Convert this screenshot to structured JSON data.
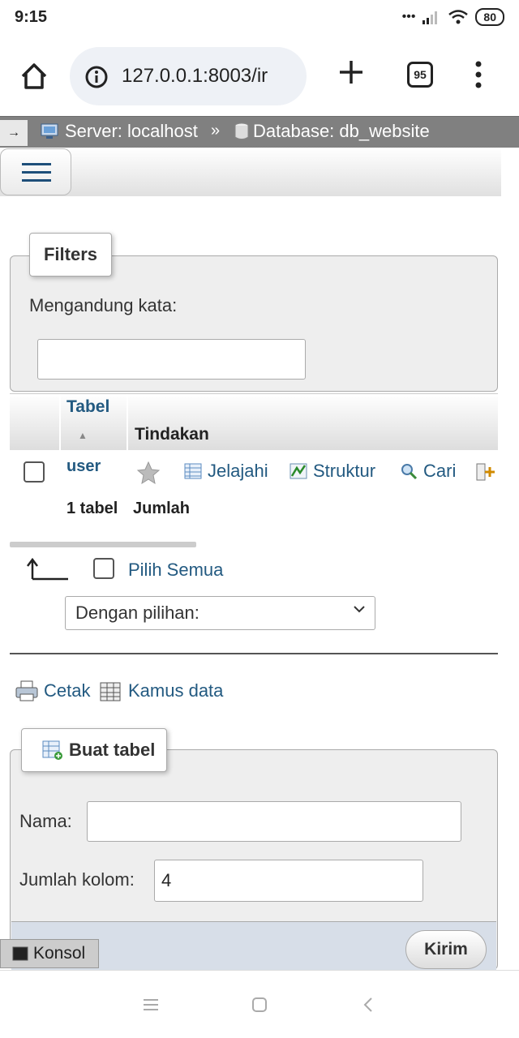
{
  "status_bar": {
    "time": "9:15",
    "battery": "80"
  },
  "browser": {
    "url": "127.0.0.1:8003/ir",
    "tab_count": "95"
  },
  "breadcrumb": {
    "arrow": "→",
    "server": "Server: localhost",
    "separator": "»",
    "database": "Database: db_website"
  },
  "filters": {
    "legend": "Filters",
    "label": "Mengandung kata:",
    "value": ""
  },
  "table": {
    "col_tabel": "Tabel",
    "col_tindakan": "Tindakan",
    "rows": [
      {
        "name": "user",
        "actions": {
          "browse": "Jelajahi",
          "structure": "Struktur",
          "search": "Cari"
        }
      }
    ],
    "footer_count": "1 tabel",
    "footer_sum": "Jumlah"
  },
  "select_all": "Pilih Semua",
  "with_selected": "Dengan pilihan:",
  "tools": {
    "print": "Cetak",
    "dictionary": "Kamus data"
  },
  "create_table": {
    "legend": "Buat tabel",
    "name_label": "Nama:",
    "name_value": "",
    "cols_label": "Jumlah kolom:",
    "cols_value": "4",
    "submit": "Kirim"
  },
  "console": "Konsol",
  "colors": {
    "link": "#235a81",
    "crumb_bg": "#808080",
    "panel_bg": "#eeeeee",
    "submit_area": "#d7dee8"
  }
}
